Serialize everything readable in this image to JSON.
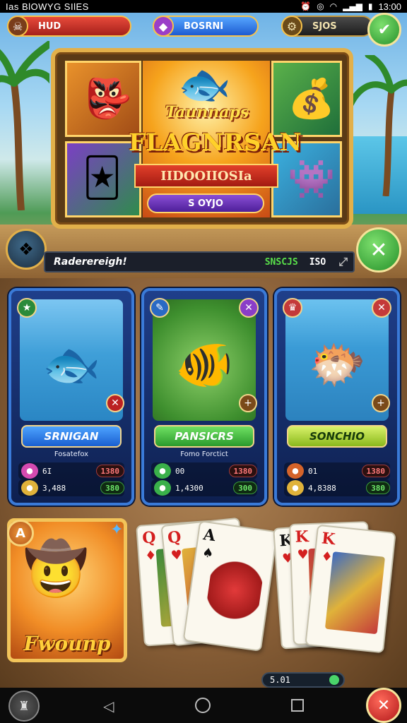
{
  "status_bar": {
    "title": "Ias BlOWYG SIlES",
    "time": "13:00"
  },
  "hud": {
    "left_label": "HUD",
    "mid_label": "BOSRNI",
    "right_label": "SJOS",
    "top_action_icon": "checkmark-icon"
  },
  "banner": {
    "logo_small": "Taunnaps",
    "logo_big": "FLAGNRSAN",
    "ribbon": "IIDOOIIOSIa",
    "button": "S OYJO"
  },
  "info_bar": {
    "name": "Raderereigh!",
    "stat_label": "SNSCJS",
    "stat_value": "ISO"
  },
  "cards": [
    {
      "title": "SRNIGAN",
      "subtitle": "Fosatefox",
      "row1_count": "6I",
      "row1_value": "1380",
      "row2_count": "3,488",
      "row2_value": "380"
    },
    {
      "title": "PANSICRS",
      "subtitle": "Fomo Forctict",
      "row1_count": "00",
      "row1_value": "1380",
      "row2_count": "1,4300",
      "row2_value": "300"
    },
    {
      "title": "SONCHIO",
      "subtitle": "",
      "row1_count": "01",
      "row1_value": "1380",
      "row2_count": "4,8388",
      "row2_value": "380"
    }
  ],
  "promo": {
    "title": "Fwounp",
    "badge": "A"
  },
  "playing_cards": [
    {
      "rank": "Q",
      "suit": "♦",
      "color": "red"
    },
    {
      "rank": "Q",
      "suit": "♥",
      "color": "red"
    },
    {
      "rank": "A",
      "suit": "♠",
      "color": "black"
    },
    {
      "rank": "K",
      "suit": "♥",
      "color": "red"
    },
    {
      "rank": "K",
      "suit": "♥",
      "color": "red"
    },
    {
      "rank": "K",
      "suit": "♦",
      "color": "red"
    }
  ],
  "chip_bar": {
    "value": "5.01"
  },
  "colors": {
    "gold": "#e2b04a",
    "card_blue": "#1f3f8a",
    "green": "#25902a",
    "red": "#b2181a"
  }
}
